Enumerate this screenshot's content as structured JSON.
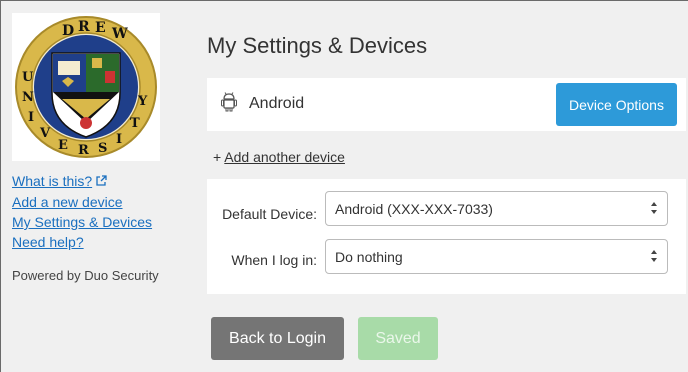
{
  "sidebar": {
    "logo_text_top": "DREW",
    "logo_text_left": "UNIVERSITY",
    "links": {
      "what_is_this": "What is this?",
      "add_new_device": "Add a new device",
      "my_settings": "My Settings & Devices",
      "need_help": "Need help?"
    },
    "powered_by": "Powered by Duo Security"
  },
  "main": {
    "title": "My Settings & Devices",
    "device": {
      "icon": "android-icon",
      "name": "Android",
      "options_label": "Device Options"
    },
    "add_another_prefix": "+ ",
    "add_another_label": "Add another device",
    "settings": {
      "default_device_label": "Default Device:",
      "default_device_value": "Android (XXX-XXX-7033)",
      "login_label": "When I log in:",
      "login_value": "Do nothing"
    },
    "buttons": {
      "back_label": "Back to Login",
      "saved_label": "Saved"
    }
  },
  "colors": {
    "accent": "#2d9ad9",
    "link": "#1a6fbf",
    "saved": "#a8dba8",
    "back": "#757575"
  }
}
